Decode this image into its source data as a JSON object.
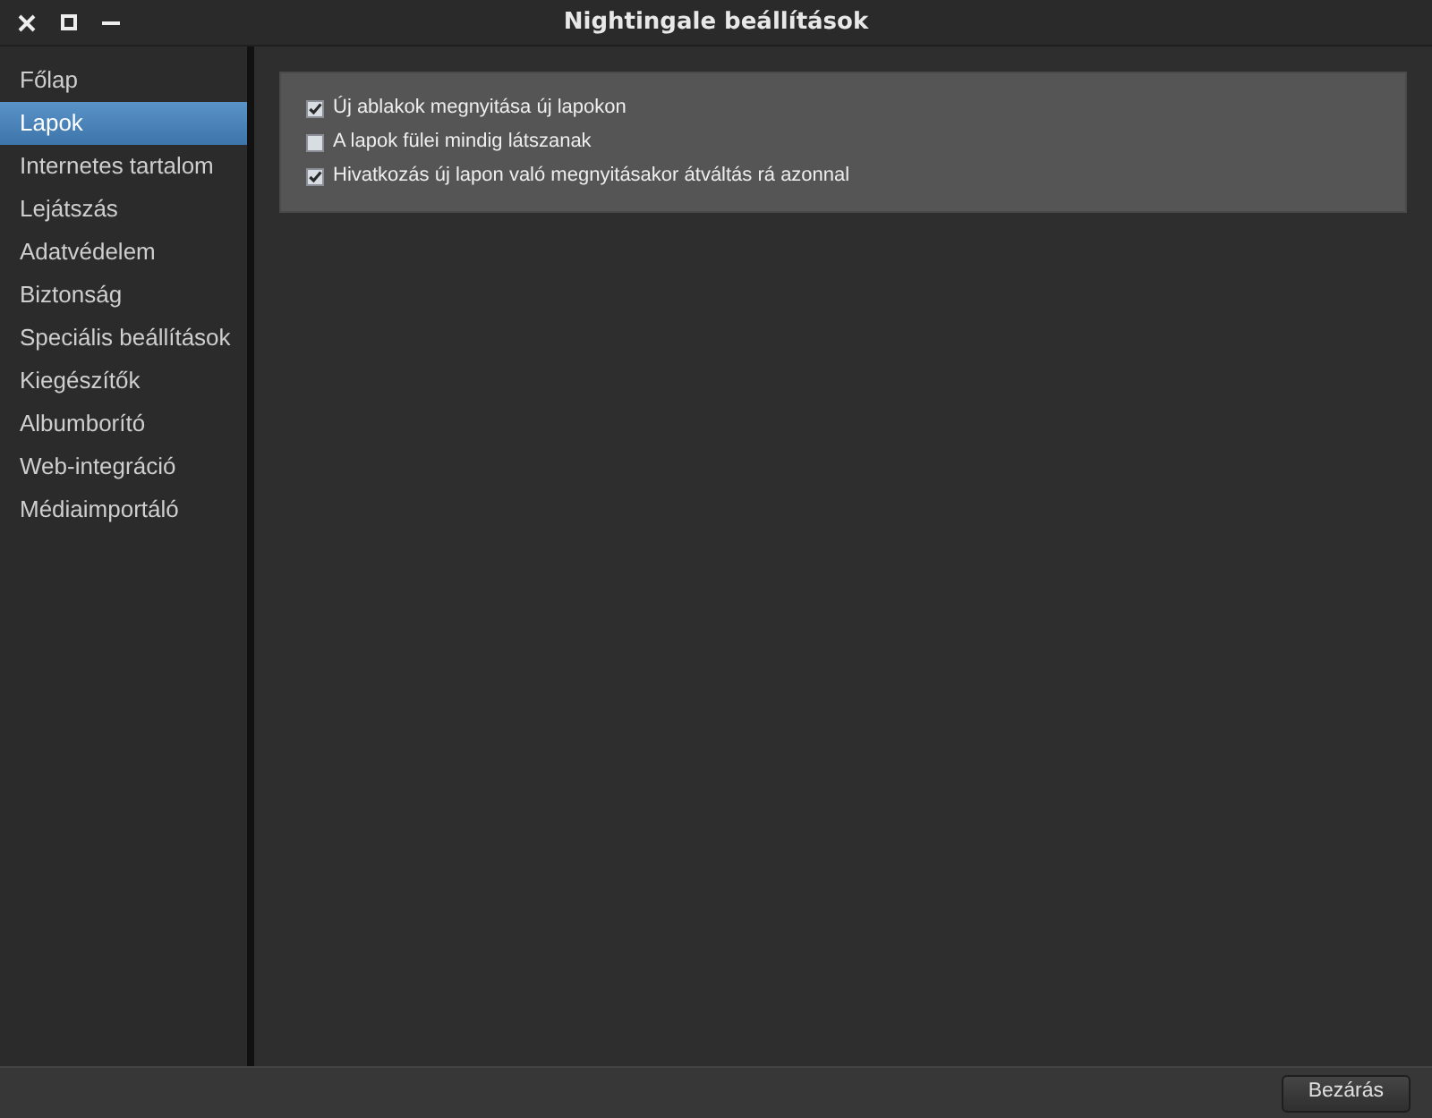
{
  "window": {
    "title": "Nightingale beállítások"
  },
  "sidebar": {
    "items": [
      {
        "label": "Főlap",
        "selected": false
      },
      {
        "label": "Lapok",
        "selected": true
      },
      {
        "label": "Internetes tartalom",
        "selected": false
      },
      {
        "label": "Lejátszás",
        "selected": false
      },
      {
        "label": "Adatvédelem",
        "selected": false
      },
      {
        "label": "Biztonság",
        "selected": false
      },
      {
        "label": "Speciális beállítások",
        "selected": false
      },
      {
        "label": "Kiegészítők",
        "selected": false
      },
      {
        "label": "Albumborító",
        "selected": false
      },
      {
        "label": "Web-integráció",
        "selected": false
      },
      {
        "label": "Médiaimportáló",
        "selected": false
      }
    ]
  },
  "options": [
    {
      "label": "Új ablakok megnyitása új lapokon",
      "checked": true
    },
    {
      "label": "A lapok fülei mindig látszanak",
      "checked": false
    },
    {
      "label": "Hivatkozás új lapon való megnyitásakor átváltás rá azonnal",
      "checked": true
    }
  ],
  "buttons": [
    "Bezárás"
  ]
}
